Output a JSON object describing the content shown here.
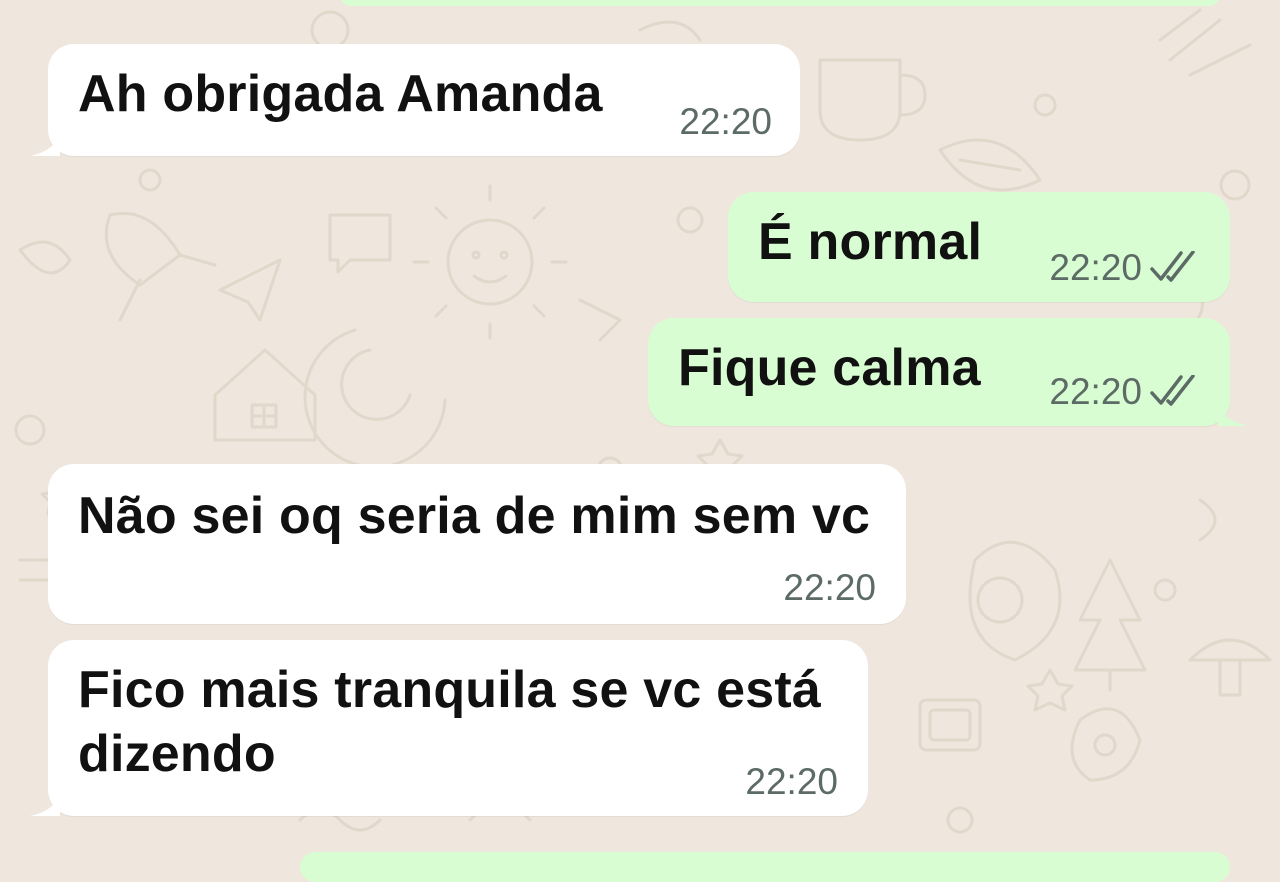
{
  "chat": {
    "colors": {
      "background": "#efe7dd",
      "incoming_bubble": "#ffffff",
      "outgoing_bubble": "#d9fdd3",
      "time": "#5d6b66",
      "text": "#111111"
    },
    "messages": [
      {
        "direction": "incoming",
        "text": "Ah obrigada Amanda",
        "time": "22:20"
      },
      {
        "direction": "outgoing",
        "text": "É normal",
        "time": "22:20",
        "status_icon": "double-check-icon"
      },
      {
        "direction": "outgoing",
        "text": "Fique calma",
        "time": "22:20",
        "status_icon": "double-check-icon"
      },
      {
        "direction": "incoming",
        "text": "Não sei oq seria de mim sem vc",
        "time": "22:20"
      },
      {
        "direction": "incoming",
        "text": "Fico mais tranquila se vc está\ndizendo",
        "time": "22:20"
      }
    ]
  }
}
